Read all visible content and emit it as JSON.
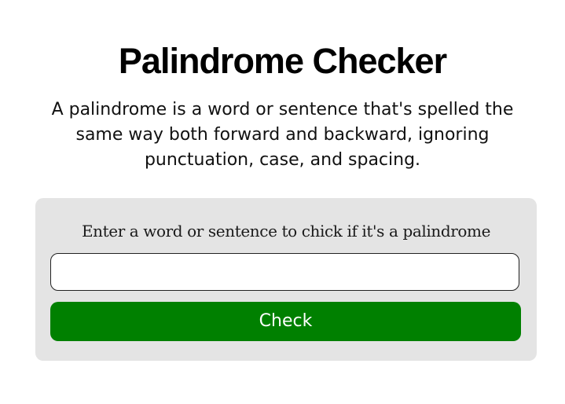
{
  "header": {
    "title": "Palindrome Checker",
    "description": "A palindrome is a word or sentence that's spelled the same way both forward and backward, ignoring punctuation, case, and spacing."
  },
  "form": {
    "label": "Enter a word or sentence to chick if it's a palindrome",
    "input_value": "",
    "input_placeholder": "",
    "button_label": "Check"
  },
  "colors": {
    "background": "#ffffff",
    "card_background": "#e4e4e4",
    "button_background": "#008000",
    "button_text": "#ffffff"
  }
}
